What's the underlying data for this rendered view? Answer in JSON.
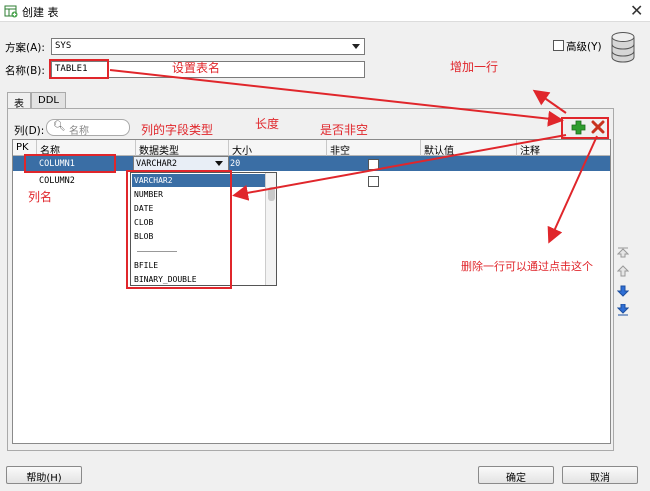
{
  "window": {
    "title": "创建 表",
    "close_glyph": "✕"
  },
  "schema": {
    "label": "方案(A):",
    "value": "SYS"
  },
  "advanced": {
    "label": "高级(Y)"
  },
  "name": {
    "label": "名称(B):",
    "value": "TABLE1"
  },
  "tabs": [
    {
      "label": "表"
    },
    {
      "label": "DDL"
    }
  ],
  "columns_section": {
    "label": "列(D):",
    "search_placeholder": "名称"
  },
  "grid": {
    "headers": [
      "PK",
      "名称",
      "数据类型",
      "大小",
      "非空",
      "默认值",
      "注释"
    ],
    "rows": [
      {
        "pk": "",
        "name": "COLUMN1",
        "type": "VARCHAR2",
        "size": "20",
        "not_null": false,
        "selected": true
      },
      {
        "pk": "",
        "name": "COLUMN2",
        "type": "",
        "size": "",
        "not_null": false,
        "selected": false
      }
    ]
  },
  "type_options": [
    "VARCHAR2",
    "NUMBER",
    "DATE",
    "CLOB",
    "BLOB",
    "BFILE",
    "BINARY_DOUBLE"
  ],
  "toolbar_icons": [
    "add-icon",
    "delete-icon"
  ],
  "move_icons": [
    "move-top-icon",
    "move-up-icon",
    "move-down-icon",
    "move-bottom-icon"
  ],
  "buttons": {
    "help": "帮助(H)",
    "ok": "确定",
    "cancel": "取消"
  },
  "annotations": {
    "set_table_name": "设置表名",
    "add_row": "增加一行",
    "field_type": "列的字段类型",
    "length": "长度",
    "not_null": "是否非空",
    "column_name": "列名",
    "delete_row": "删除一行可以通过点击这个"
  },
  "colors": {
    "annotation": "#e0262b",
    "selection": "#3a6ea5",
    "add": "#2e9d2e",
    "delete": "#c8321e",
    "move_arrow": "#2f6fd6"
  }
}
